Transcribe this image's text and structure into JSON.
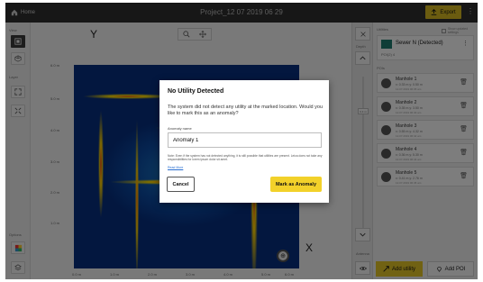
{
  "topbar": {
    "home_label": "Home",
    "title": "Project_12 07 2019 06 29",
    "export_label": "Export",
    "more_glyph": "⋮"
  },
  "left_toolbar": {
    "view_label": "View",
    "layer_label": "Layer",
    "options_label": "Options"
  },
  "canvas": {
    "y_axis_letter": "Y",
    "x_axis_letter": "X",
    "y_ticks": [
      "6.0 m",
      "5.0 m",
      "4.0 m",
      "3.0 m",
      "2.0 m",
      "1.0 m"
    ],
    "x_ticks": [
      "0.0 m",
      "1.0 m",
      "2.0 m",
      "3.0 m",
      "4.0 m",
      "5.0 m",
      "6.0 m"
    ]
  },
  "mid_toolbar": {
    "depth_label": "Depth",
    "antenna_label": "Antenna",
    "slider_value": "0.4 m"
  },
  "right_panel": {
    "utilities_label": "Utilities",
    "show_toggle_label": "Show updated settings",
    "utility": {
      "name": "Sewer N (Detected)",
      "sub": "POI(2) 4"
    },
    "pois_label": "POIs",
    "pois": [
      {
        "name": "Manhole 1",
        "coord": "x: 0.33 m  y: 0.50 m",
        "date": "12.07.2019 06:35 am"
      },
      {
        "name": "Manhole 2",
        "coord": "x: 0.35 m  y: 3.50 m",
        "date": "12.07.2019 06:40 am"
      },
      {
        "name": "Manhole 3",
        "coord": "x: 0.55 m  y: 4.32 m",
        "date": "12.07.2019 06:42 am"
      },
      {
        "name": "Manhole 4",
        "coord": "x: 0.36 m  y: 5.30 m",
        "date": "12.07.2019 06:44 am"
      },
      {
        "name": "Manhole 5",
        "coord": "x: 0.41 m  y: 2.76 m",
        "date": "12.07.2019 06:45 am"
      }
    ],
    "add_utility_label": "Add utility",
    "add_poi_label": "Add POI"
  },
  "dialog": {
    "title": "No Utility Detected",
    "body": "The system did not detect any utility at the marked location. Would you like to mark this as an anomaly?",
    "input_label": "Anomaly name",
    "input_value": "Anomaly 1",
    "note": "Note: Even if the system has not detected anything, it is still possible that utilities are present. Leica does not take any responsibilities for lorem ipsum dolor sit amet.",
    "link": "Read More",
    "cancel_label": "Cancel",
    "confirm_label": "Mark as Anomaly"
  },
  "colors": {
    "accent": "#f2d12a",
    "topbar": "#2e2e2e",
    "utility_icon": "#1e7a6e"
  }
}
